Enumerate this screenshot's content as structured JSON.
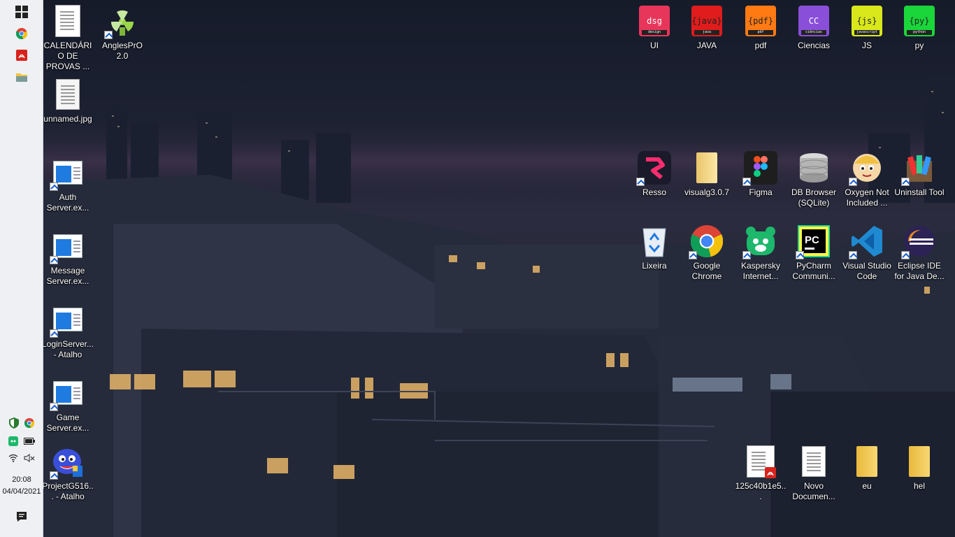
{
  "taskbar": {
    "pinned": [
      {
        "name": "start-button",
        "icon": "windows-icon"
      },
      {
        "name": "chrome-taskbar",
        "icon": "chrome-icon"
      },
      {
        "name": "acrobat-taskbar",
        "icon": "acrobat-icon"
      },
      {
        "name": "explorer-taskbar",
        "icon": "folder-icon"
      }
    ],
    "clock": {
      "time": "20:08",
      "date": "04/04/2021"
    },
    "colors": {
      "background": "#eef0f3"
    }
  },
  "desktop": {
    "left_icons": [
      {
        "label": "CALENDÁRIO DE PROVAS ...",
        "icon": "document-image-icon"
      },
      {
        "label": "AnglesPrO 2.0",
        "icon": "radiation-icon"
      },
      {
        "label": "unnamed.jpg",
        "icon": "document-image-icon"
      },
      {
        "label": "Auth Server.ex...",
        "icon": "executable-icon"
      },
      {
        "label": "Message Server.ex...",
        "icon": "executable-icon"
      },
      {
        "label": "LoginServer... - Atalho",
        "icon": "executable-icon"
      },
      {
        "label": "Game Server.ex...",
        "icon": "executable-icon"
      },
      {
        "label": "ProjectG516... - Atalho",
        "icon": "game-character-icon"
      }
    ],
    "top_right_icons": [
      {
        "label": "UI",
        "badge": "dsg",
        "sub": "design",
        "color": "#e8365a"
      },
      {
        "label": "JAVA",
        "badge": "{java}",
        "sub": "java",
        "color": "#e01c1c"
      },
      {
        "label": "pdf",
        "badge": "{pdf}",
        "sub": "pdf",
        "color": "#ff7a12"
      },
      {
        "label": "Ciencias",
        "badge": "CC",
        "sub": "ciências",
        "color": "#8a4fd8"
      },
      {
        "label": "JS",
        "badge": "{js}",
        "sub": "javascript",
        "color": "#d8e81a"
      },
      {
        "label": "py",
        "badge": "{py}",
        "sub": "python",
        "color": "#1ad63a"
      }
    ],
    "middle_right_row1": [
      {
        "label": "Resso",
        "icon": "resso-icon"
      },
      {
        "label": "visualg3.0.7",
        "icon": "folder-icon"
      },
      {
        "label": "Figma",
        "icon": "figma-icon"
      },
      {
        "label": "DB Browser (SQLite)",
        "icon": "database-icon"
      },
      {
        "label": "Oxygen Not Included ...",
        "icon": "oxygen-not-included-icon"
      },
      {
        "label": "Uninstall Tool",
        "icon": "uninstall-tool-icon"
      }
    ],
    "middle_right_row2": [
      {
        "label": "Lixeira",
        "icon": "recycle-bin-icon"
      },
      {
        "label": "Google Chrome",
        "icon": "chrome-icon"
      },
      {
        "label": "Kaspersky Internet...",
        "icon": "kaspersky-icon"
      },
      {
        "label": "PyCharm Communi...",
        "icon": "pycharm-icon"
      },
      {
        "label": "Visual Studio Code",
        "icon": "vscode-icon"
      },
      {
        "label": "Eclipse IDE for Java De...",
        "icon": "eclipse-icon"
      }
    ],
    "bottom_right_icons": [
      {
        "label": "125c40b1e5...",
        "icon": "pdf-file-icon"
      },
      {
        "label": "Novo Documen...",
        "icon": "text-file-icon"
      },
      {
        "label": "eu",
        "icon": "folder-icon"
      },
      {
        "label": "hel",
        "icon": "folder-icon"
      }
    ]
  }
}
